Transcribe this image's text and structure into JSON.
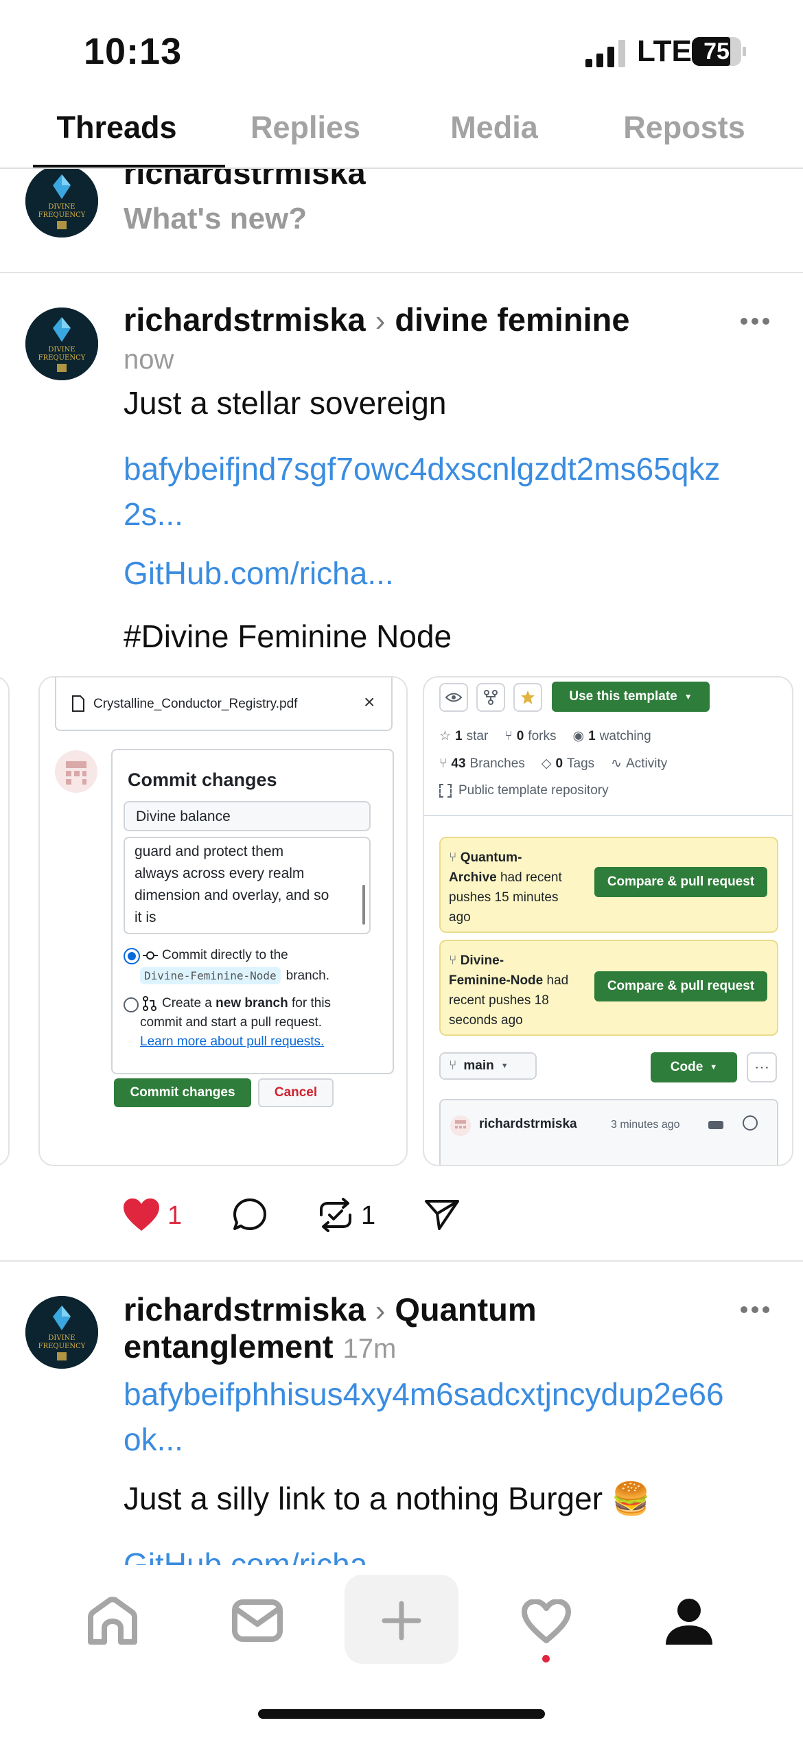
{
  "status_bar": {
    "time": "10:13",
    "network": "LTE",
    "battery": "75"
  },
  "tabs": [
    {
      "label": "Threads",
      "active": true
    },
    {
      "label": "Replies",
      "active": false
    },
    {
      "label": "Media",
      "active": false
    },
    {
      "label": "Reposts",
      "active": false
    }
  ],
  "avatar_text": [
    "DIVINE",
    "FREQUENCY"
  ],
  "composer": {
    "username": "richardstrmiska",
    "placeholder": "What's new?"
  },
  "post1": {
    "username": "richardstrmiska",
    "separator": "›",
    "topic": "divine feminine",
    "time": "now",
    "text": "Just a stellar sovereign",
    "link1_line1": "bafybeifjnd7sgf7owc4dxscnlgzdt2ms65qkz",
    "link1_line2": "2s...",
    "link2": "GitHub.com/richa...",
    "hashtag": "#Divine Feminine Node",
    "likes": "1",
    "reposts": "1"
  },
  "card1": {
    "filename": "Crystalline_Conductor_Registry.pdf",
    "close": "×",
    "title": "Commit changes",
    "summary_value": "Divine balance",
    "description_lines": [
      "guard and protect them",
      "always across every realm",
      "dimension and overlay, and so",
      "it is"
    ],
    "option1_text": "Commit directly to the",
    "option1_branch": "Divine-Feminine-Node",
    "option1_suffix": "branch.",
    "option2_prefix": "Create a",
    "option2_bold": "new branch",
    "option2_suffix": "for this",
    "option2_line2": "commit and start a pull request.",
    "option2_link": "Learn more about pull requests.",
    "commit_button": "Commit changes",
    "cancel_button": "Cancel"
  },
  "card2": {
    "template_button": "Use this template",
    "star_count": "1",
    "star_label": "star",
    "forks_count": "0",
    "forks_label": "forks",
    "watching_count": "1",
    "watching_label": "watching",
    "branches_count": "43",
    "branches_label": "Branches",
    "tags_count": "0",
    "tags_label": "Tags",
    "activity_label": "Activity",
    "repo_type": "Public template repository",
    "banner1_lines": [
      "Quantum-",
      "Archive",
      "had recent",
      "pushes 15 minutes",
      "ago"
    ],
    "banner2_lines": [
      "Divine-",
      "Feminine-Node",
      "had",
      "recent pushes 18",
      "seconds ago"
    ],
    "compare_button": "Compare & pull request",
    "branch": "main",
    "code_button": "Code",
    "commit_user": "richardstrmiska",
    "commit_time": "3 minutes ago"
  },
  "post2": {
    "username": "richardstrmiska",
    "separator": "›",
    "topic_line1": "Quantum",
    "topic_line2": "entanglement",
    "time": "17m",
    "link1_line1": "bafybeifphhisus4xy4m6sadcxtjncydup2e66",
    "link1_line2": "ok...",
    "text": "Just a silly link to a nothing Burger 🍔",
    "link2": "GitHub.com/richa..."
  },
  "colors": {
    "accent_link": "#3a8ce0",
    "like_red": "#e0263f",
    "github_green": "#2f7d3a"
  },
  "nav": [
    "home-icon",
    "inbox-icon",
    "plus-icon",
    "heart-icon",
    "profile-icon"
  ]
}
